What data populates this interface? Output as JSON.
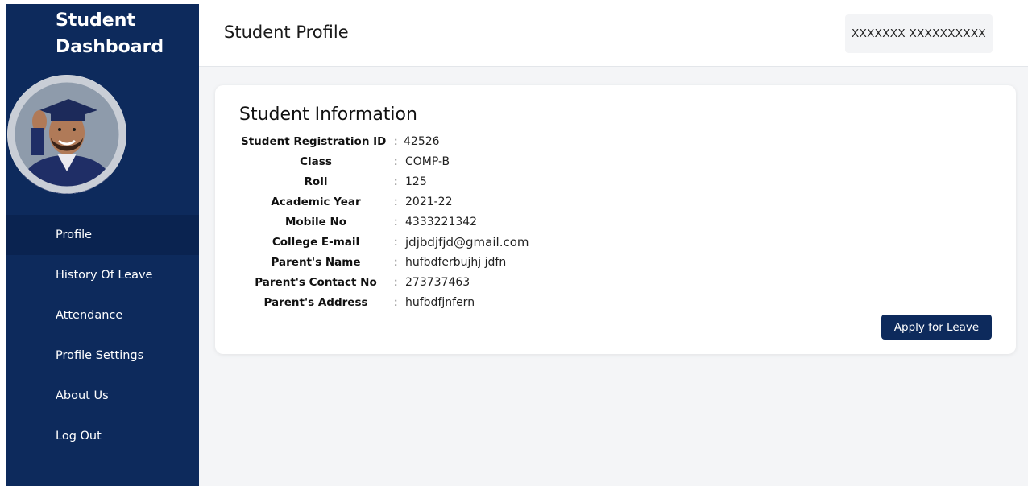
{
  "sidebar": {
    "brand_line1": "Student",
    "brand_line2": "Dashboard",
    "items": [
      {
        "label": "Profile",
        "active": true
      },
      {
        "label": "History Of Leave"
      },
      {
        "label": "Attendance"
      },
      {
        "label": "Profile Settings"
      },
      {
        "label": "About Us"
      },
      {
        "label": "Log Out"
      }
    ]
  },
  "header": {
    "title": "Student Profile",
    "user_name": "XXXXXXX XXXXXXXXXX"
  },
  "card": {
    "title": "Student Information",
    "rows": [
      {
        "label": "Student Registration ID",
        "value": "42526",
        "sep": ":"
      },
      {
        "label": "Class",
        "value": "COMP-B",
        "sep": ":"
      },
      {
        "label": "Roll",
        "value": "125",
        "sep": ":"
      },
      {
        "label": "Academic Year",
        "value": "2021-22",
        "sep": ":"
      },
      {
        "label": "Mobile No",
        "value": "4333221342",
        "sep": ":"
      },
      {
        "label": "College E-mail",
        "value": "jdjbdjfjd@gmail.com",
        "sep": ":"
      },
      {
        "label": "Parent's Name",
        "value": "hufbdferbujhj jdfn",
        "sep": ":"
      },
      {
        "label": "Parent's Contact No",
        "value": "273737463",
        "sep": ":"
      },
      {
        "label": "Parent's Address",
        "value": "hufbdfjnfern",
        "sep": ":"
      }
    ],
    "apply_button": "Apply for Leave"
  },
  "colors": {
    "sidebar_bg": "#0d2a5c",
    "active_item_bg": "#0a2350",
    "main_bg": "#f4f5f7",
    "button_bg": "#0d2a5c"
  }
}
